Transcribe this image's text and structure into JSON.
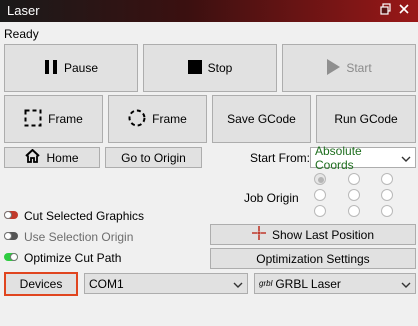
{
  "window": {
    "title": "Laser",
    "restore_icon": "restore-icon",
    "close_icon": "close-icon"
  },
  "status": "Ready",
  "buttons": {
    "pause": "Pause",
    "stop": "Stop",
    "start": "Start",
    "frame_rect": "Frame",
    "frame_circle": "Frame",
    "save_gcode": "Save GCode",
    "run_gcode": "Run GCode",
    "home": "Home",
    "go_to_origin": "Go to Origin",
    "show_last_position": "Show Last Position",
    "optimization_settings": "Optimization Settings",
    "devices": "Devices"
  },
  "start_from": {
    "label": "Start From:",
    "value": "Absolute Coords"
  },
  "job_origin": {
    "label": "Job Origin",
    "selected": "top-left"
  },
  "options": {
    "cut_selected": {
      "label": "Cut Selected Graphics",
      "on": false,
      "color": "#c0392b"
    },
    "use_selection_origin": {
      "label": "Use Selection Origin",
      "on": false,
      "color": "#555555"
    },
    "optimize_cut_path": {
      "label": "Optimize Cut Path",
      "on": true,
      "color": "#2ecc40"
    }
  },
  "port": {
    "value": "COM1"
  },
  "device": {
    "logo": "grbl",
    "value": "GRBL Laser"
  },
  "colors": {
    "highlight_border": "#e0451f",
    "start_from_text": "#1e6e1e"
  }
}
